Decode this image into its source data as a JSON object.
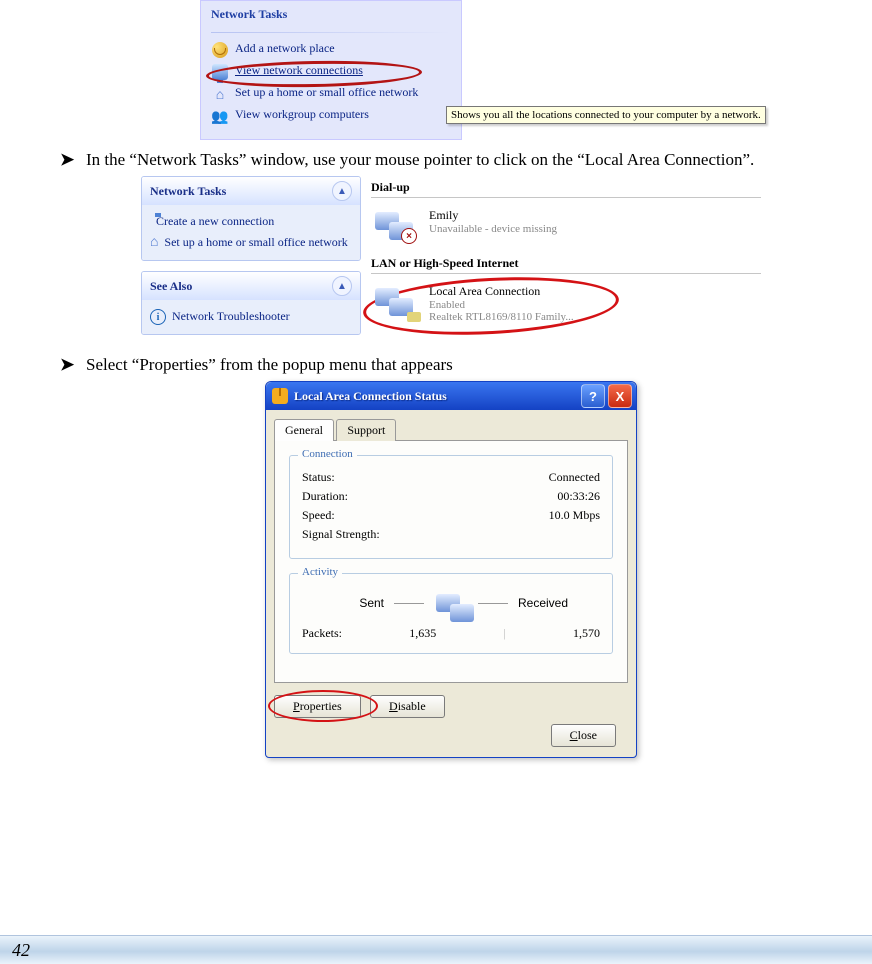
{
  "fig1": {
    "heading": "Network Tasks",
    "items": [
      {
        "icon": "globe",
        "label": "Add a network place"
      },
      {
        "icon": "pcnet",
        "label": "View network connections",
        "highlight": true
      },
      {
        "icon": "home",
        "label": "Set up a home or small office network"
      },
      {
        "icon": "group",
        "label": "View workgroup computers"
      }
    ],
    "tooltip": "Shows you all the locations connected to your computer by a network."
  },
  "bullet1": "In the “Network Tasks” window, use your mouse pointer to click on the “Local Area Connection”.",
  "fig2": {
    "box1": {
      "title": "Network Tasks",
      "items": [
        {
          "icon": "pcnet",
          "label": "Create a new connection"
        },
        {
          "icon": "home",
          "label": "Set up a home or small office network"
        }
      ]
    },
    "box2": {
      "title": "See Also",
      "items": [
        {
          "icon": "info",
          "label": "Network Troubleshooter"
        }
      ]
    },
    "group1": "Dial-up",
    "item1": {
      "name": "Emily",
      "status": "Unavailable - device missing"
    },
    "group2": "LAN or High-Speed Internet",
    "item2": {
      "name": "Local Area Connection",
      "status": "Enabled",
      "device": "Realtek RTL8169/8110 Family..."
    }
  },
  "bullet2": "Select “Properties” from the popup menu that appears",
  "dlg": {
    "title": "Local Area Connection Status",
    "help": "?",
    "close": "X",
    "tabs": {
      "general": "General",
      "support": "Support"
    },
    "conn": {
      "legend": "Connection",
      "status_l": "Status:",
      "status_v": "Connected",
      "duration_l": "Duration:",
      "duration_v": "00:33:26",
      "speed_l": "Speed:",
      "speed_v": "10.0 Mbps",
      "signal_l": "Signal Strength:"
    },
    "act": {
      "legend": "Activity",
      "sent": "Sent",
      "received": "Received",
      "packets_l": "Packets:",
      "sent_v": "1,635",
      "recv_v": "1,570"
    },
    "btns": {
      "properties": "Properties",
      "disable": "Disable",
      "close": "Close"
    }
  },
  "page_number": "42"
}
